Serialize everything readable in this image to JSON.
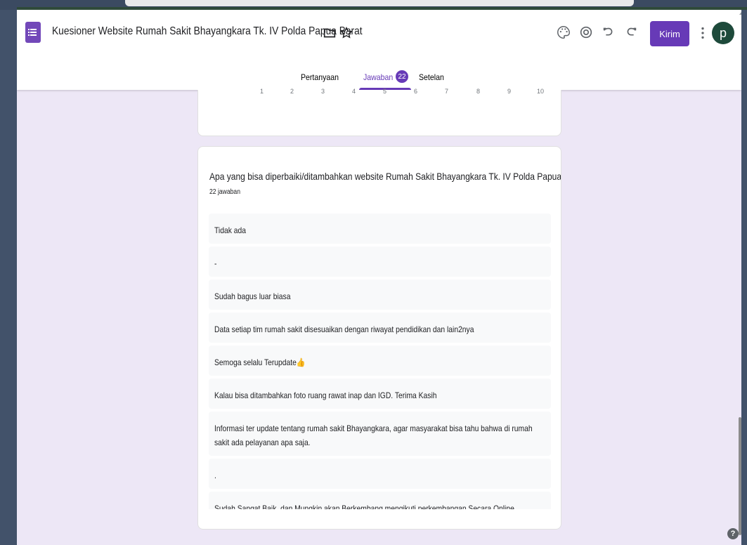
{
  "header": {
    "title": "Kuesioner Website Rumah Sakit Bhayangkara Tk. IV Polda Papua Barat",
    "send_label": "Kirim",
    "avatar_letter": "p"
  },
  "tabs": [
    {
      "label": "Pertanyaan"
    },
    {
      "label": "Jawaban"
    },
    {
      "label": "Setelan"
    }
  ],
  "responses_badge": "22",
  "scale": [
    "1",
    "2",
    "3",
    "4",
    "5",
    "6",
    "7",
    "8",
    "9",
    "10"
  ],
  "question": {
    "text": "Apa yang bisa diperbaiki/ditambahkan website Rumah Sakit Bhayangkara Tk. IV Polda Papua Barat  ?",
    "count": "22 jawaban",
    "answers": [
      "Tidak ada",
      "-",
      "Sudah bagus luar biasa",
      "Data setiap tim rumah sakit disesuaikan dengan riwayat pendidikan dan lain2nya",
      "Semoga selalu Terupdate👍",
      "Kalau bisa ditambahkan foto ruang rawat inap dan IGD. Terima Kasih",
      "Informasi ter update tentang rumah sakit Bhayangkara, agar masyarakat bisa tahu bahwa di rumah sakit ada pelayanan apa saja.",
      ".",
      "Sudah Sangat Baik, dan Mungkin akan Berkembang mengikuti perkembangan Secara Online"
    ]
  },
  "help_label": "?",
  "colors": {
    "accent": "#673ab7",
    "background": "#ede7f6"
  }
}
